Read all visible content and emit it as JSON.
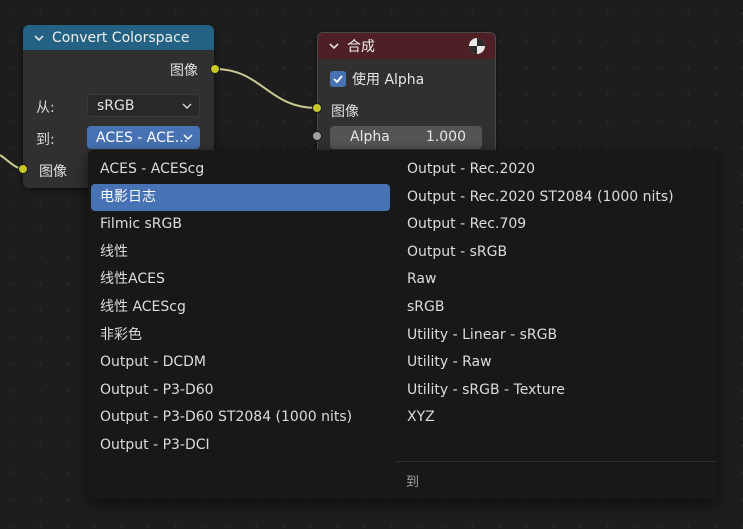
{
  "convert_node": {
    "title": "Convert Colorspace",
    "output_label": "图像",
    "from_label": "从:",
    "from_value": "sRGB",
    "to_label": "到:",
    "to_value": "ACES - ACE...",
    "input_label": "图像"
  },
  "composite_node": {
    "title": "合成",
    "use_alpha_label": "使用 Alpha",
    "use_alpha_checked": true,
    "image_label": "图像",
    "alpha_label": "Alpha",
    "alpha_value": "1.000"
  },
  "menu": {
    "title": "到",
    "selected": "电影日志",
    "left_items": [
      "ACES - ACEScg",
      "电影日志",
      "Filmic sRGB",
      "线性",
      "线性ACES",
      "线性 ACEScg",
      "非彩色",
      "Output - DCDM",
      "Output - P3-D60",
      "Output - P3-D60 ST2084 (1000 nits)",
      "Output - P3-DCI"
    ],
    "right_items": [
      "Output - Rec.2020",
      "Output - Rec.2020 ST2084 (1000 nits)",
      "Output - Rec.709",
      "Output - sRGB",
      "Raw",
      "sRGB",
      "Utility - Linear - sRGB",
      "Utility - Raw",
      "Utility - sRGB - Texture",
      "XYZ"
    ]
  },
  "colors": {
    "canvas_bg": "#1d1d1d",
    "converter_header": "#246283",
    "output_header": "#4e1f25",
    "selection": "#4772b3",
    "socket_color": "#c7c729",
    "socket_float": "#a1a1a1"
  }
}
